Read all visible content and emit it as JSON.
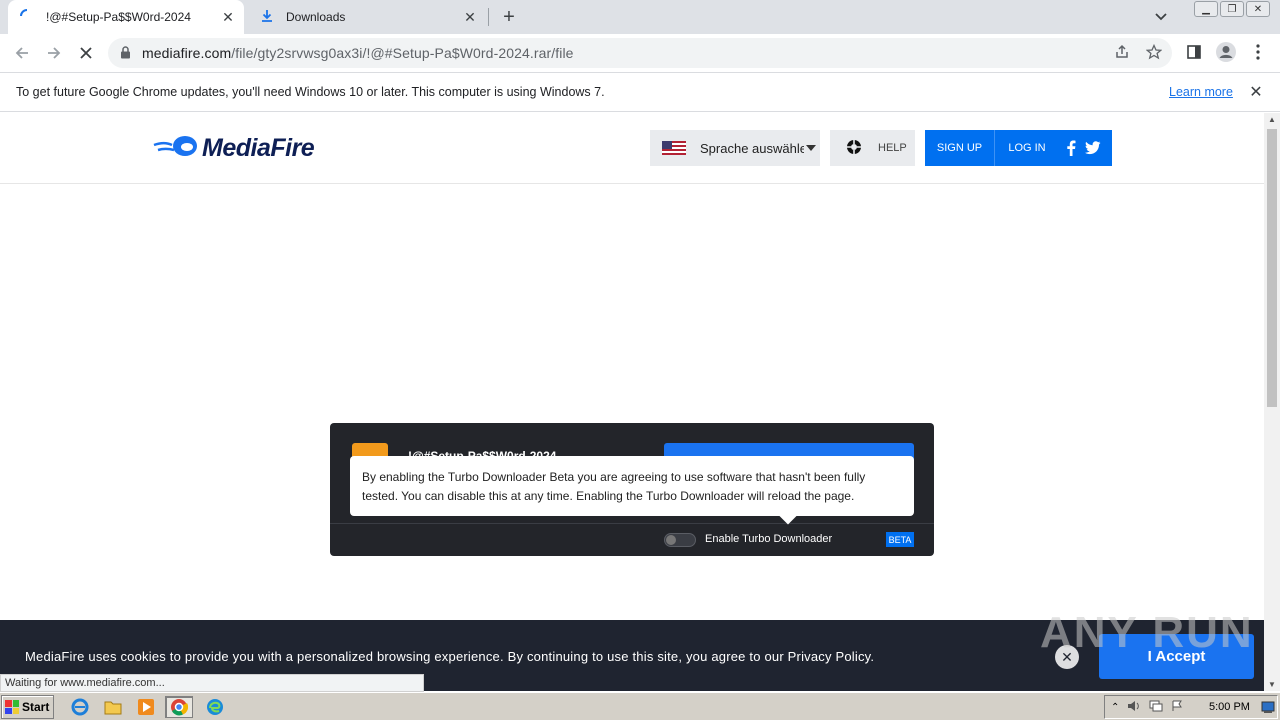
{
  "browser": {
    "tabs": [
      {
        "label": "!@#Setup-Pa$$W0rd-2024",
        "active": true
      },
      {
        "label": "Downloads",
        "active": false
      }
    ],
    "url_host": "mediafire.com",
    "url_path": "/file/gty2srvwsg0ax3i/!@#Setup-Pa$W0rd-2024.rar/file",
    "infobar": {
      "message": "To get future Google Chrome updates, you'll need Windows 10 or later. This computer is using Windows 7.",
      "learn_more": "Learn more"
    },
    "status_text": "Waiting for www.mediafire.com..."
  },
  "header": {
    "logo_text": "MediaFire",
    "language_label": "Sprache auswählen",
    "help_label": "HELP",
    "signup_label": "SIGN UP",
    "login_label": "LOG IN"
  },
  "download_card": {
    "file_name": "!@#Setup-Pa$$W0rd-2024",
    "tooltip_text": "By enabling the Turbo Downloader Beta you are agreeing to use software that hasn't been fully tested. You can disable this at any time. Enabling the Turbo Downloader will reload the page.",
    "toggle_label": "Enable Turbo Downloader",
    "toggle_on": false,
    "beta_label": "BETA"
  },
  "cookie_bar": {
    "text": "MediaFire uses cookies to provide you with a personalized browsing experience. By continuing to use this site, you agree to our Privacy Policy.",
    "accept_label": "I Accept"
  },
  "watermark": "ANY RUN",
  "taskbar": {
    "start_label": "Start",
    "clock": "5:00 PM"
  },
  "colors": {
    "mediafire_blue": "#0070f0",
    "cookie_bg": "#1f2430",
    "card_bg": "#23252a"
  }
}
